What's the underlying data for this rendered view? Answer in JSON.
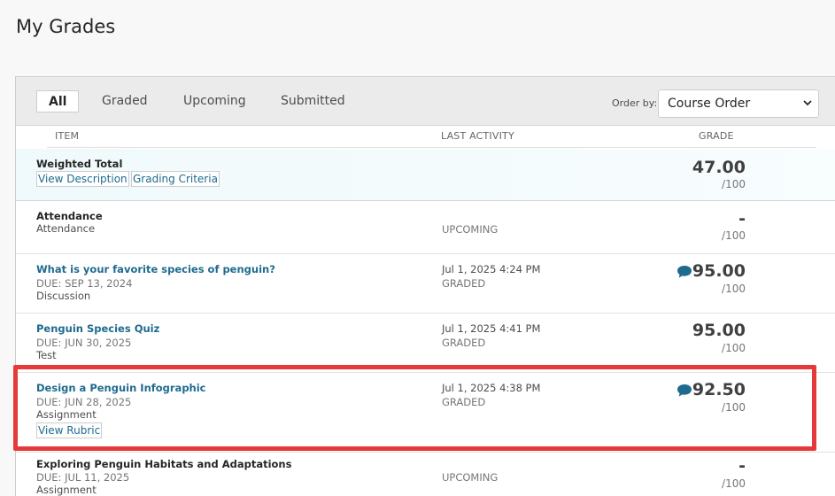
{
  "page": {
    "title": "My Grades"
  },
  "filters": {
    "tabs": [
      {
        "label": "All",
        "active": true
      },
      {
        "label": "Graded",
        "active": false
      },
      {
        "label": "Upcoming",
        "active": false
      },
      {
        "label": "Submitted",
        "active": false
      }
    ],
    "order_label": "Order by:",
    "order_value": "Course Order"
  },
  "columns": {
    "item": "ITEM",
    "activity": "LAST ACTIVITY",
    "grade": "GRADE"
  },
  "rows": [
    {
      "title": "Weighted Total",
      "links": [
        "View Description",
        "Grading Criteria"
      ],
      "grade": "47.00",
      "max": "/100"
    },
    {
      "title": "Attendance",
      "subtitle": "Attendance",
      "status": "UPCOMING",
      "grade": "-",
      "max": "/100"
    },
    {
      "title": "What is your favorite species of penguin?",
      "due": "DUE: SEP 13, 2024",
      "type": "Discussion",
      "activity_date": "Jul 1, 2025 4:24 PM",
      "status": "GRADED",
      "grade": "95.00",
      "max": "/100",
      "has_comment": true
    },
    {
      "title": "Penguin Species Quiz",
      "due": "DUE: JUN 30, 2025",
      "type": "Test",
      "activity_date": "Jul 1, 2025 4:41 PM",
      "status": "GRADED",
      "grade": "95.00",
      "max": "/100",
      "has_comment": false
    },
    {
      "title": "Design a Penguin Infographic",
      "due": "DUE: JUN 28, 2025",
      "type": "Assignment",
      "link": "View Rubric",
      "activity_date": "Jul 1, 2025 4:38 PM",
      "status": "GRADED",
      "grade": "92.50",
      "max": "/100",
      "has_comment": true
    },
    {
      "title": "Exploring Penguin Habitats and Adaptations",
      "due": "DUE: JUL 11, 2025",
      "type": "Assignment",
      "status": "UPCOMING",
      "grade": "-",
      "max": "/100"
    }
  ],
  "colors": {
    "link": "#1e6b8f",
    "highlight": "#e63a3a",
    "comment_icon": "#1e6b8f"
  },
  "icons": {
    "comment": "comment-icon",
    "select": "chevron-down-icon"
  }
}
